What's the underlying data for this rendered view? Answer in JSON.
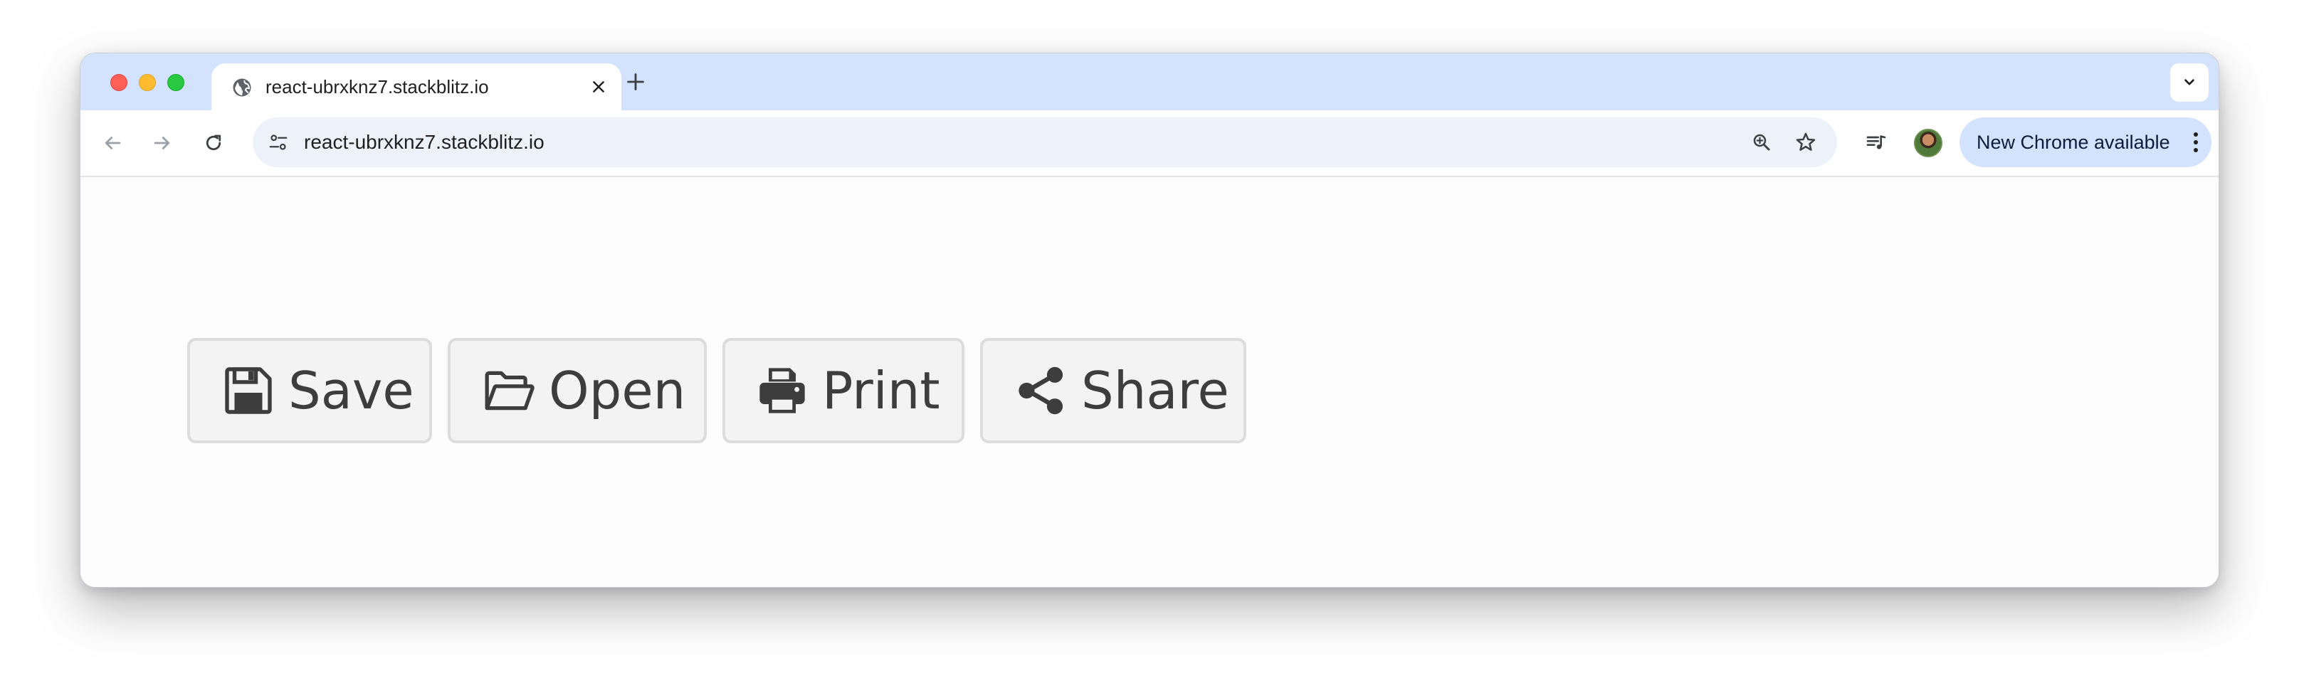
{
  "browser": {
    "tab": {
      "title": "react-ubrxknz7.stackblitz.io"
    },
    "omnibox": {
      "url": "react-ubrxknz7.stackblitz.io"
    },
    "update_button_label": "New Chrome available"
  },
  "icons": {
    "tab_favicon": "globe-icon",
    "tab_close": "close-icon",
    "new_tab": "plus-icon",
    "tab_search": "chevron-down-icon",
    "back": "arrow-left-icon",
    "forward": "arrow-right-icon",
    "reload": "reload-icon",
    "site_info": "tune-icon",
    "zoom": "zoom-in-icon",
    "bookmark": "star-icon",
    "media": "media-queue-icon",
    "menu": "kebab-menu-icon"
  },
  "toolbar_buttons": [
    {
      "label": "Save",
      "icon": "floppy-disk-icon"
    },
    {
      "label": "Open",
      "icon": "folder-open-icon"
    },
    {
      "label": "Print",
      "icon": "printer-icon"
    },
    {
      "label": "Share",
      "icon": "share-icon"
    }
  ],
  "colors": {
    "tab_strip": "#d3e3fd",
    "omnibox_bg": "#edf2fa",
    "button_bg": "#f3f3f3",
    "button_border": "#dcdcdc",
    "button_text": "#3d3d3d"
  }
}
